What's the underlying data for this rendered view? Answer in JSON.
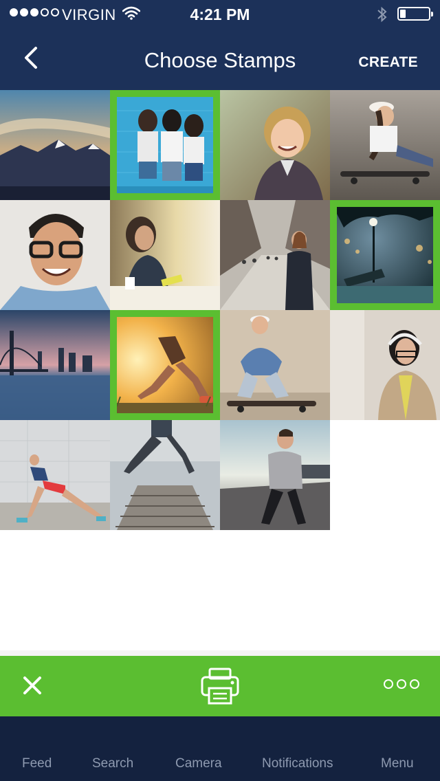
{
  "status_bar": {
    "carrier": "VIRGIN",
    "time": "4:21 PM",
    "signal_bars_filled": 3,
    "signal_bars_total": 5,
    "battery_level": 0.2
  },
  "nav": {
    "title": "Choose Stamps",
    "create_label": "CREATE",
    "back_icon": "chevron-left-icon"
  },
  "colors": {
    "header_bg": "#1c3159",
    "accent_green": "#5bbe31",
    "tab_bar_bg": "#14223f",
    "tab_text": "#8e9ab0"
  },
  "photos": [
    {
      "name": "photo-mountains",
      "selected": false
    },
    {
      "name": "photo-three-friends-selfie",
      "selected": true
    },
    {
      "name": "photo-smiling-woman",
      "selected": false
    },
    {
      "name": "photo-skateboard-girl",
      "selected": false
    },
    {
      "name": "photo-man-glasses",
      "selected": false
    },
    {
      "name": "photo-woman-cafe",
      "selected": false
    },
    {
      "name": "photo-city-street",
      "selected": false
    },
    {
      "name": "photo-park-bench-night",
      "selected": true
    },
    {
      "name": "photo-bridge-skyline",
      "selected": false
    },
    {
      "name": "photo-runner-sunset",
      "selected": true
    },
    {
      "name": "photo-crouching-skater",
      "selected": false
    },
    {
      "name": "photo-headphones-woman",
      "selected": false
    },
    {
      "name": "photo-stretching-woman",
      "selected": false
    },
    {
      "name": "photo-jumping-pier",
      "selected": false
    },
    {
      "name": "photo-resting-runner",
      "selected": false
    }
  ],
  "action_bar": {
    "close_icon": "close-icon",
    "print_icon": "printer-icon",
    "more_icon": "more-icon"
  },
  "tabs": [
    {
      "label": "Feed"
    },
    {
      "label": "Search"
    },
    {
      "label": "Camera"
    },
    {
      "label": "Notifications"
    },
    {
      "label": "Menu"
    }
  ]
}
